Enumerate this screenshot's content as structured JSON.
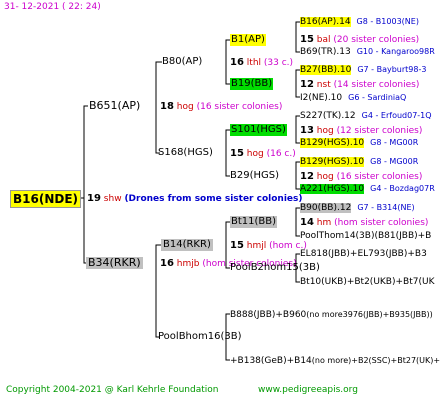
{
  "header": {
    "date": "31- 12-2021 ( 22: 24)"
  },
  "footer": {
    "copyright": "Copyright 2004-2021 @ Karl Kehrle Foundation",
    "url": "www.pedigreeapis.org"
  },
  "root": {
    "label": "B16(NDE)",
    "drones_num": "19",
    "drones_code": "shw",
    "drones_note": "(Drones from some sister colonies)"
  },
  "queen": {
    "label": "B651(AP)",
    "num": "18",
    "code": "hog",
    "note": "(16 sister colonies)"
  },
  "drone_mother": {
    "label": "B34(RKR)",
    "num": "16",
    "code": "hmjb",
    "note": "(hom sister colonies)"
  },
  "qm": {
    "label": "B80(AP)",
    "num": "16",
    "code": "lthl",
    "note": "(33 c.)"
  },
  "qd": {
    "label": "S168(HGS)",
    "num": "15",
    "code": "hog",
    "note": "(16 c.)"
  },
  "dm": {
    "label": "B14(RKR)",
    "num": "15",
    "code": "hmjl",
    "note": "(hom c.)"
  },
  "dd": {
    "label": "PoolBhom16(3B)"
  },
  "qmm": {
    "label": "B1(AP)",
    "num": "15",
    "code": "bal",
    "note": "(20 sister colonies)"
  },
  "qmd": {
    "label": "B19(BB)",
    "num": "12",
    "code": "nst",
    "note": "(14 sister colonies)"
  },
  "qdm": {
    "label": "S101(HGS)",
    "num": "13",
    "code": "hog",
    "note": "(12 sister colonies)"
  },
  "qdd": {
    "label": "B29(HGS)",
    "num": "12",
    "code": "hog",
    "note": "(16 sister colonies)"
  },
  "dmm": {
    "label": "Bt11(BB)",
    "num": "14",
    "code": "hm",
    "note": "(hom sister colonies)"
  },
  "dmd": {
    "label": "PoolB2hom15(3B)"
  },
  "ddm": {
    "label": "B888(JBB)+B960",
    "extra": "(no more3976(JBB)+B935(JBB))"
  },
  "ddd": {
    "label": "+B138(GeB)+B14",
    "extra": "(no more)+B2(SSC)+Bt27(UK)+"
  },
  "gen4": [
    {
      "label": "B16(AP).14",
      "code": "G8 - B1003(NE)",
      "hl": "yellow"
    },
    {
      "label": "B69(TR).13",
      "code": "G10 - Kangaroo98R",
      "hl": ""
    },
    {
      "label": "B27(BB).10",
      "code": "G7 - Bayburt98-3",
      "hl": "yellow"
    },
    {
      "label": "I2(NE).10",
      "code": "G6 - SardiniaQ",
      "hl": ""
    },
    {
      "label": "S227(TK).12",
      "code": "G4 - Erfoud07-1Q",
      "hl": ""
    },
    {
      "label": "B129(HGS).10",
      "code": "G8 - MG00R",
      "hl": "yellow"
    },
    {
      "label": "B129(HGS).10",
      "code": "G8 - MG00R",
      "hl": "yellow"
    },
    {
      "label": "A221(HGS).10",
      "code": "G4 - Bozdag07R",
      "hl": "green"
    },
    {
      "label": "B90(BB).12",
      "code": "G7 - B314(NE)",
      "hl": "grey"
    },
    {
      "label": "PoolThom14(3B)(B81(JBB)+B",
      "code": "",
      "hl": ""
    },
    {
      "label": "EL818(JBB)+EL793(JBB)+B3",
      "code": "",
      "hl": ""
    },
    {
      "label": "Bt10(UKB)+Bt2(UKB)+Bt7(UK",
      "code": "",
      "hl": ""
    }
  ]
}
